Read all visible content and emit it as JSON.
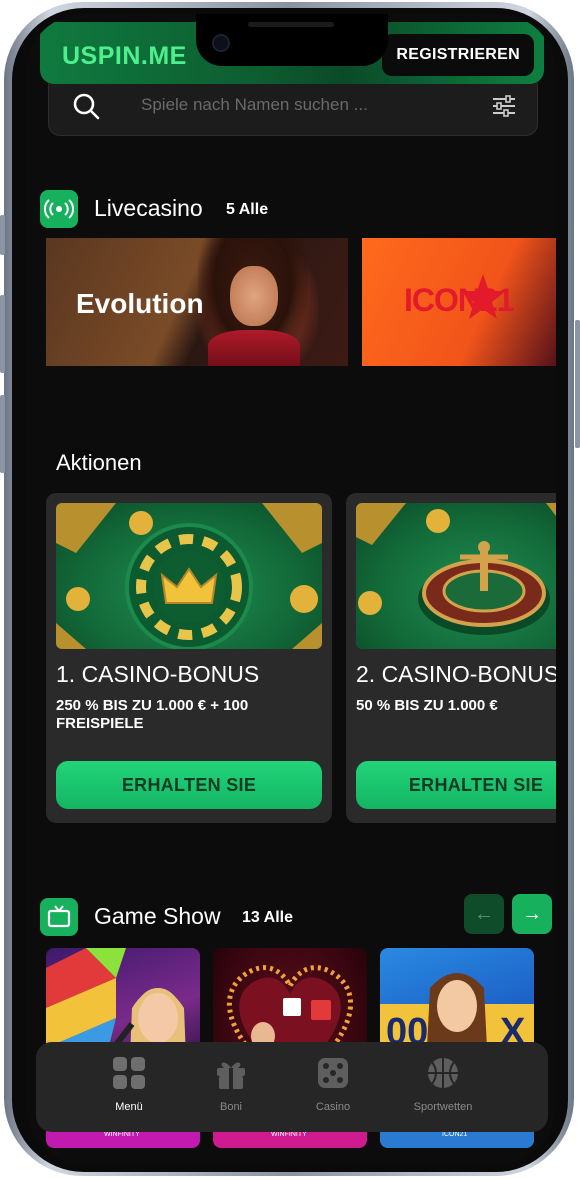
{
  "header": {
    "logo": "USPIN.ME",
    "register_label": "REGISTRIEREN"
  },
  "search": {
    "placeholder": "Spiele nach Namen suchen ..."
  },
  "livecasino": {
    "title": "Livecasino",
    "count": "5 Alle",
    "providers": [
      "Evolution",
      "ICON21"
    ]
  },
  "promotions": {
    "title": "Aktionen",
    "cards": [
      {
        "title": "1. CASINO-BONUS",
        "desc": "250 % BIS ZU 1.000 € + 100 FREISPIELE",
        "button": "ERHALTEN SIE"
      },
      {
        "title": "2. CASINO-BONUS",
        "desc": "50 % BIS ZU 1.000 €",
        "button": "ERHALTEN SIE"
      }
    ]
  },
  "gameshow": {
    "title": "Game Show",
    "count": "13 Alle",
    "tiles": [
      "WINFINITY",
      "WINFINITY",
      "ICON21"
    ]
  },
  "bottom_nav": {
    "items": [
      {
        "label": "Menü",
        "icon": "grid-icon",
        "active": true
      },
      {
        "label": "Boni",
        "icon": "gift-icon",
        "active": false
      },
      {
        "label": "Casino",
        "icon": "dice-icon",
        "active": false
      },
      {
        "label": "Sportwetten",
        "icon": "basketball-icon",
        "active": false
      }
    ]
  },
  "colors": {
    "accent": "#17b15d",
    "logo_green": "#4ef08e",
    "background": "#0c0c0c"
  }
}
